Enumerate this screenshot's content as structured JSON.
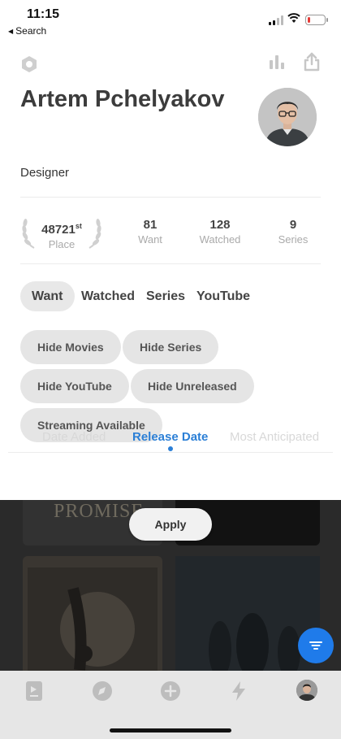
{
  "status_bar": {
    "time": "11:15",
    "back_label": "Search",
    "back_icon": "◀",
    "battery_level": 0.15,
    "battery_color": "#e53935"
  },
  "header": {
    "left_icon": "hexagon-icon",
    "right_icons": [
      "bar-chart-icon",
      "share-icon"
    ]
  },
  "profile": {
    "name": "Artem Pchelyakov",
    "role": "Designer"
  },
  "stats": {
    "place": {
      "value": "48721",
      "suffix": "st",
      "label": "Place"
    },
    "want": {
      "value": "81",
      "label": "Want"
    },
    "watched": {
      "value": "128",
      "label": "Watched"
    },
    "series": {
      "value": "9",
      "label": "Series"
    }
  },
  "list_tabs": [
    "Want",
    "Watched",
    "Series",
    "YouTube"
  ],
  "active_list_tab": "Want",
  "filters": [
    "Hide Movies",
    "Hide Series",
    "Hide YouTube",
    "Hide Unreleased",
    "Streaming Available"
  ],
  "sort": {
    "options": [
      "Date Added",
      "Release Date",
      "Most Anticipated"
    ],
    "active": "Release Date"
  },
  "grid": {
    "poster_title": "PROMISE"
  },
  "apply_label": "Apply",
  "fab_icon": "filter-icon",
  "tab_bar": {
    "icons": [
      "watchlist-icon",
      "compass-icon",
      "add-icon",
      "lightning-icon",
      "avatar"
    ]
  },
  "colors": {
    "accent": "#2b7fd6",
    "fab": "#1f7bea",
    "chip": "#e5e5e5"
  }
}
